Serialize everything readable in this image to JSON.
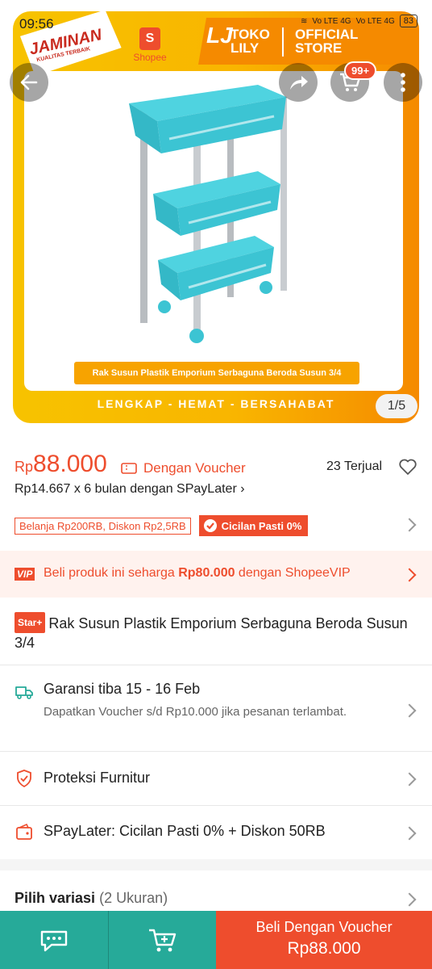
{
  "status": {
    "time": "09:56",
    "battery": "83",
    "net1": "Vo LTE 4G",
    "net2": "Vo LTE 4G"
  },
  "banner": {
    "jaminan": "JAMINAN",
    "jaminan_sub": "KUALITAS TERBAIK",
    "shopee": "Shopee",
    "store_name": "TOKO LILY",
    "store_badge": "OFFICIAL STORE",
    "caption": "Rak Susun Plastik Emporium Serbaguna Beroda Susun 3/4",
    "tagline": "LENGKAP - HEMAT - BERSAHABAT"
  },
  "cart_badge": "99+",
  "pager": "1/5",
  "price": {
    "currency": "Rp",
    "amount": "88.000",
    "voucher_label": "Dengan Voucher",
    "sold": "23 Terjual"
  },
  "installment": "Rp14.667 x 6 bulan dengan SPayLater",
  "chips": {
    "discount": "Belanja Rp200RB, Diskon Rp2,5RB",
    "cicilan": "Cicilan Pasti 0%"
  },
  "vip": {
    "logo": "VIP",
    "text_prefix": "Beli produk ini seharga ",
    "vip_price": "Rp80.000",
    "text_suffix": " dengan ShopeeVIP"
  },
  "product": {
    "badge": "Star+",
    "title": "Rak Susun Plastik Emporium Serbaguna Beroda Susun 3/4"
  },
  "shipping": {
    "title": "Garansi tiba 15 - 16 Feb",
    "subtitle": "Dapatkan Voucher s/d Rp10.000 jika pesanan terlambat."
  },
  "protection": "Proteksi Furnitur",
  "spaylater": "SPayLater: Cicilan Pasti 0% + Diskon 50RB",
  "variasi": {
    "label": "Pilih variasi",
    "count": "(2 Ukuran)"
  },
  "bottom": {
    "buy_line1": "Beli Dengan Voucher",
    "buy_line2": "Rp88.000"
  },
  "colors": {
    "accent": "#ee4d2d",
    "teal": "#26aa99",
    "banner": "#f9b500"
  }
}
